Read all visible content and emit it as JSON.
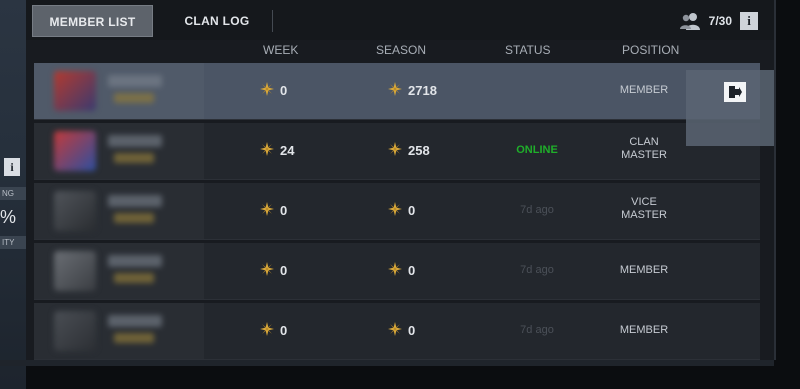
{
  "left_panel": {
    "info_label": "i",
    "label_top": "NG",
    "percent": "%",
    "label_bottom": "ITY"
  },
  "tabs": [
    {
      "label": "MEMBER LIST",
      "active": true
    },
    {
      "label": "CLAN LOG",
      "active": false
    }
  ],
  "member_count": "7/30",
  "info_label": "i",
  "columns": {
    "player": "",
    "week": "WEEK",
    "season": "SEASON",
    "status": "STATUS",
    "position": "POSITION"
  },
  "members": [
    {
      "week": "0",
      "season": "2718",
      "status": "",
      "status_type": "online",
      "position": "MEMBER",
      "selected": true
    },
    {
      "week": "24",
      "season": "258",
      "status": "ONLINE",
      "status_type": "online",
      "position": "CLAN\nMASTER",
      "selected": false
    },
    {
      "week": "0",
      "season": "0",
      "status": "7d ago",
      "status_type": "offline",
      "position": "VICE\nMASTER",
      "selected": false
    },
    {
      "week": "0",
      "season": "0",
      "status": "7d ago",
      "status_type": "offline",
      "position": "MEMBER",
      "selected": false
    },
    {
      "week": "0",
      "season": "0",
      "status": "7d ago",
      "status_type": "offline",
      "position": "MEMBER",
      "selected": false
    }
  ],
  "colors": {
    "online": "#1fae2a",
    "offline": "#4b5058",
    "selected_row": "#4b5565",
    "row": "#23272d",
    "star": "#d9a93a"
  },
  "icons": {
    "members": "people-icon",
    "star": "star-icon",
    "leave": "exit-icon"
  }
}
